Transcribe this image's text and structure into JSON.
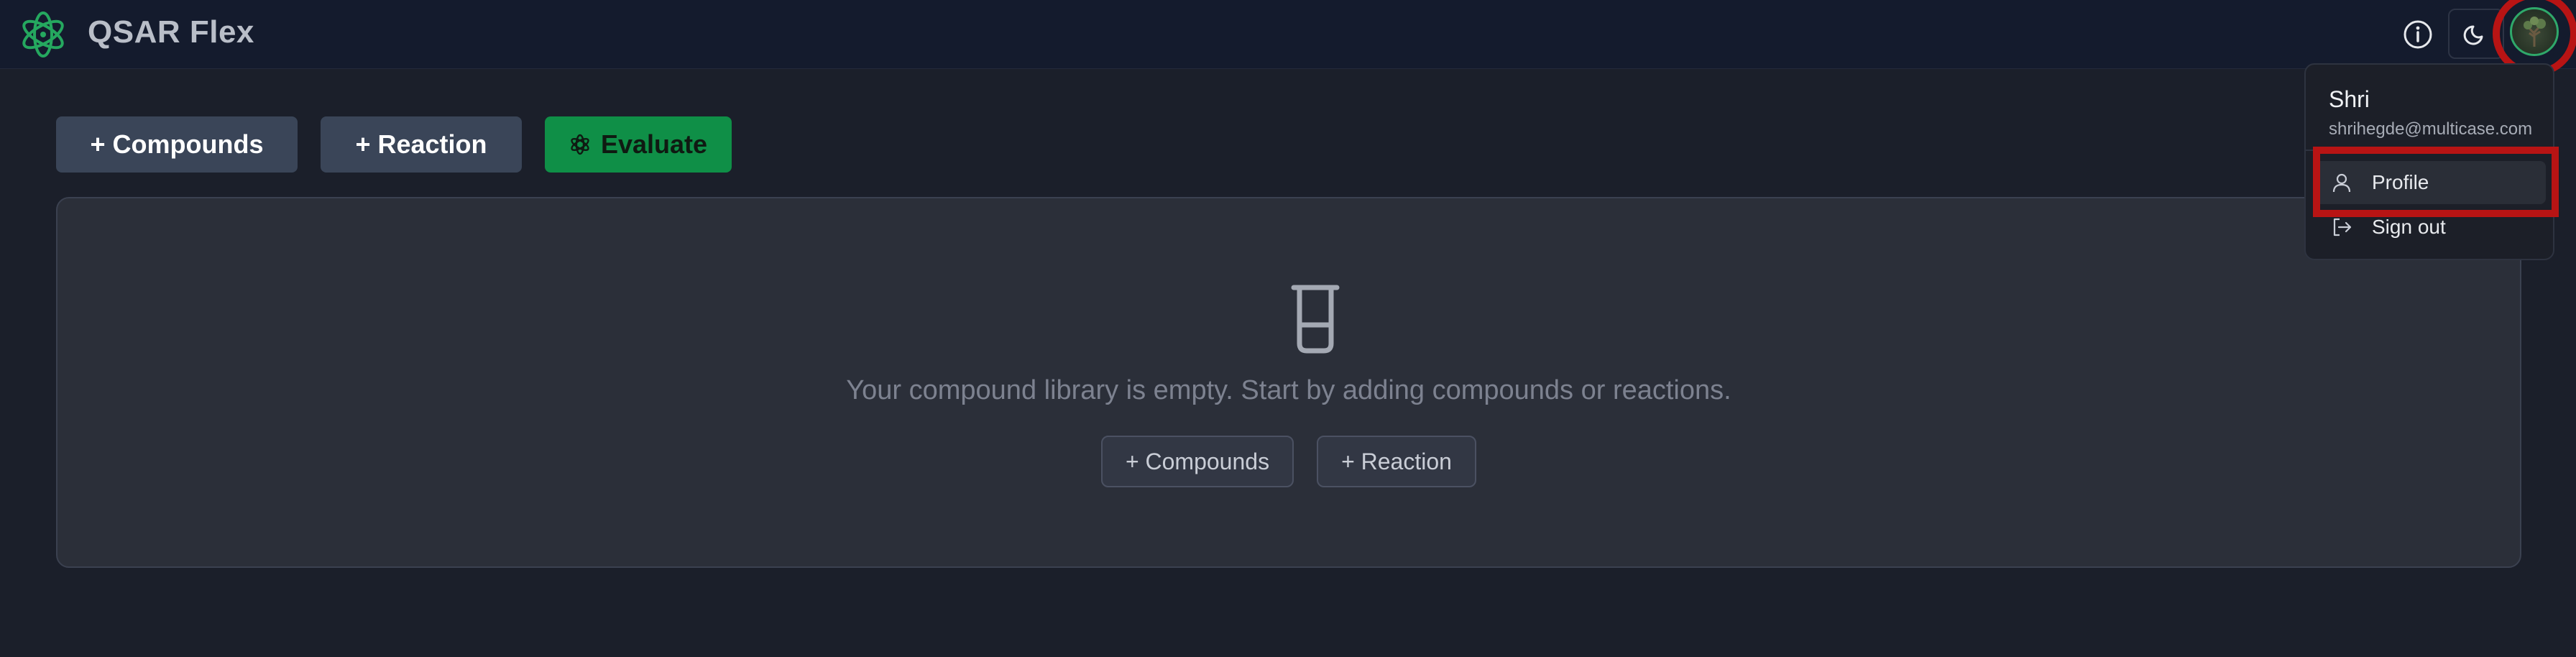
{
  "header": {
    "app_title": "QSAR Flex",
    "logo_icon": "atom-flower-logo-icon",
    "info_icon": "info-icon",
    "theme_icon": "moon-icon",
    "avatar_icon": "user-avatar"
  },
  "toolbar": {
    "compounds_label": "+ Compounds",
    "reaction_label": "+ Reaction",
    "evaluate_label": "Evaluate",
    "evaluate_icon": "atom-icon"
  },
  "library": {
    "empty_icon": "beaker-icon",
    "empty_message": "Your compound library is empty. Start by adding compounds or reactions.",
    "compounds_label": "+ Compounds",
    "reaction_label": "+ Reaction"
  },
  "user_menu": {
    "name": "Shri",
    "email": "shrihegde@multicase.com",
    "items": [
      {
        "label": "Profile",
        "icon": "user-icon"
      },
      {
        "label": "Sign out",
        "icon": "sign-out-icon"
      }
    ]
  },
  "colors": {
    "accent": "#0f8f47",
    "highlight": "#b81414",
    "background": "#1b1f2a"
  }
}
